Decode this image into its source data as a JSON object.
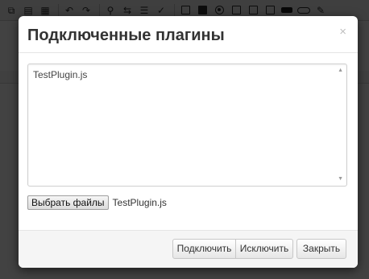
{
  "toolbar": {
    "icons": [
      "copy-icon",
      "paste-icon",
      "paste-text-icon",
      "undo-icon",
      "redo-icon",
      "find-icon",
      "replace-icon",
      "select-all-icon",
      "spellcheck-icon",
      "form-icon",
      "checkbox-icon",
      "radio-icon",
      "textfield-icon",
      "textarea-icon",
      "select-icon",
      "button-icon",
      "image-button-icon",
      "hidden-field-icon"
    ]
  },
  "modal": {
    "title": "Подключенные плагины",
    "close_glyph": "×",
    "plugins": [
      "TestPlugin.js"
    ],
    "file_button_label": "Выбрать файлы",
    "selected_file": "TestPlugin.js",
    "buttons": {
      "connect": "Подключить",
      "exclude": "Исключить",
      "close": "Закрыть"
    }
  }
}
